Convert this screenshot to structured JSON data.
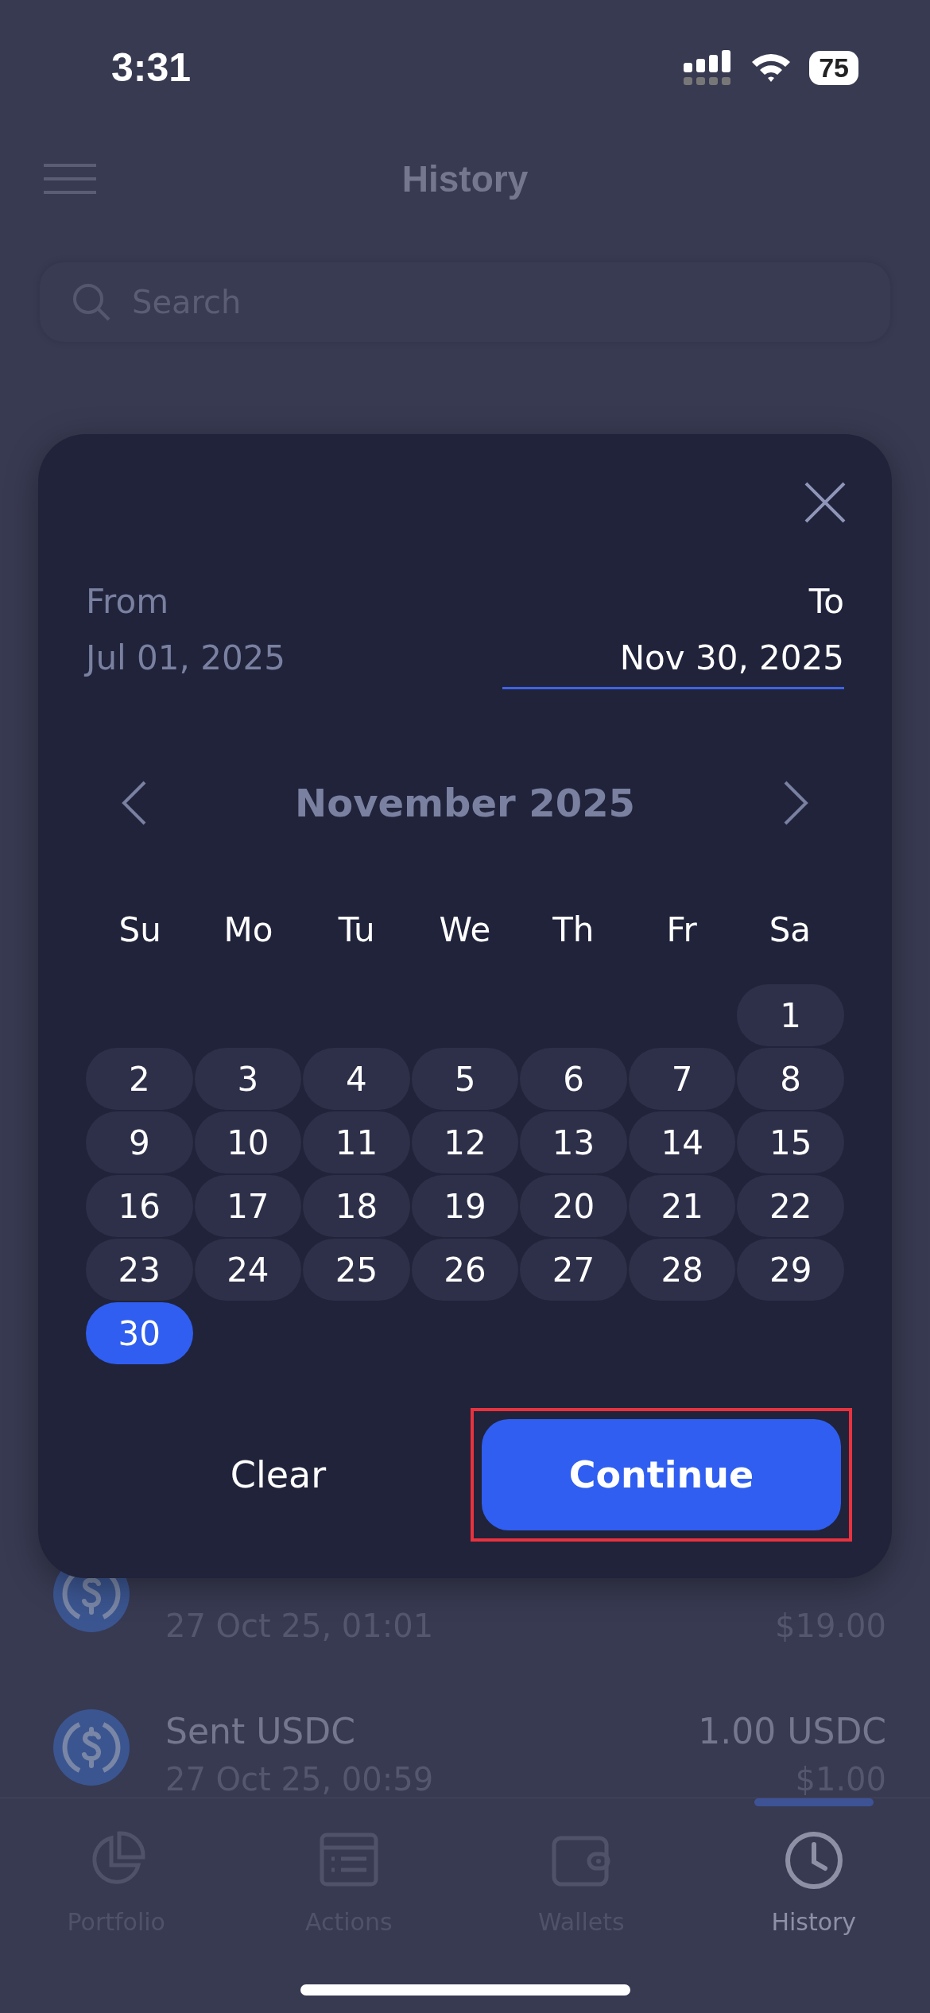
{
  "status_bar": {
    "time": "3:31",
    "battery": "75"
  },
  "header": {
    "title": "History"
  },
  "search": {
    "placeholder": "Search"
  },
  "transactions": [
    {
      "date": "27 Oct 25, 01:01",
      "value": "$19.00"
    },
    {
      "title": "Sent USDC",
      "date": "27 Oct 25, 00:59",
      "amount": "1.00 USDC",
      "value": "$1.00"
    }
  ],
  "tab_bar": [
    {
      "label": "Portfolio",
      "kind": "pie",
      "selected": false
    },
    {
      "label": "Actions",
      "kind": "list",
      "selected": false
    },
    {
      "label": "Wallets",
      "kind": "wallet",
      "selected": false
    },
    {
      "label": "History",
      "kind": "clock",
      "selected": true
    }
  ],
  "date_picker": {
    "from": {
      "label": "From",
      "value": "Jul 01, 2025",
      "selected": false
    },
    "to": {
      "label": "To",
      "value": "Nov 30, 2025",
      "selected": true
    },
    "month": "November 2025",
    "weekdays": [
      "Su",
      "Mo",
      "Tu",
      "We",
      "Th",
      "Fr",
      "Sa"
    ],
    "weeks": [
      [
        {
          "day": "1",
          "selected": false
        }
      ],
      [
        {
          "day": "2",
          "selected": false
        },
        {
          "day": "3",
          "selected": false
        },
        {
          "day": "4",
          "selected": false
        },
        {
          "day": "5",
          "selected": false
        },
        {
          "day": "6",
          "selected": false
        },
        {
          "day": "7",
          "selected": false
        },
        {
          "day": "8",
          "selected": false
        }
      ],
      [
        {
          "day": "9",
          "selected": false
        },
        {
          "day": "10",
          "selected": false
        },
        {
          "day": "11",
          "selected": false
        },
        {
          "day": "12",
          "selected": false
        },
        {
          "day": "13",
          "selected": false
        },
        {
          "day": "14",
          "selected": false
        },
        {
          "day": "15",
          "selected": false
        }
      ],
      [
        {
          "day": "16",
          "selected": false
        },
        {
          "day": "17",
          "selected": false
        },
        {
          "day": "18",
          "selected": false
        },
        {
          "day": "19",
          "selected": false
        },
        {
          "day": "20",
          "selected": false
        },
        {
          "day": "21",
          "selected": false
        },
        {
          "day": "22",
          "selected": false
        }
      ],
      [
        {
          "day": "23",
          "selected": false
        },
        {
          "day": "24",
          "selected": false
        },
        {
          "day": "25",
          "selected": false
        },
        {
          "day": "26",
          "selected": false
        },
        {
          "day": "27",
          "selected": false
        },
        {
          "day": "28",
          "selected": false
        },
        {
          "day": "29",
          "selected": false
        }
      ],
      [
        {
          "day": "30",
          "selected": true
        }
      ]
    ],
    "clear_button": "Clear",
    "continue_button": {
      "label": "Continue",
      "highlighted": true
    }
  }
}
